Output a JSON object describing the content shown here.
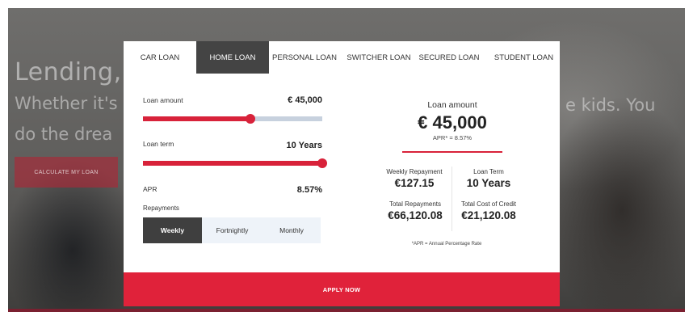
{
  "hero": {
    "title": "Lending,",
    "line1_left": "Whether it's",
    "line2_left": "do the drea",
    "line1_right": "e kids. You",
    "cta_label": "CALCULATE MY LOAN"
  },
  "calculator": {
    "tabs": [
      {
        "label": "CAR LOAN",
        "active": false
      },
      {
        "label": "HOME LOAN",
        "active": true
      },
      {
        "label": "PERSONAL LOAN",
        "active": false
      },
      {
        "label": "SWITCHER LOAN",
        "active": false
      },
      {
        "label": "SECURED LOAN",
        "active": false
      },
      {
        "label": "STUDENT LOAN",
        "active": false
      }
    ],
    "loan_amount": {
      "label": "Loan amount",
      "value": "€ 45,000",
      "slider_fraction": 0.6
    },
    "loan_term": {
      "label": "Loan term",
      "value": "10 Years",
      "slider_fraction": 1.0
    },
    "apr": {
      "label": "APR",
      "value": "8.57%"
    },
    "repayments": {
      "label": "Repayments",
      "options": [
        {
          "label": "Weekly",
          "active": true
        },
        {
          "label": "Fortnightly",
          "active": false
        },
        {
          "label": "Monthly",
          "active": false
        }
      ]
    },
    "summary": {
      "title": "Loan amount",
      "amount": "€ 45,000",
      "apr_line": "APR* = 8.57%",
      "weekly_repayment_label": "Weekly Repayment",
      "weekly_repayment_value": "€127.15",
      "loan_term_label": "Loan Term",
      "loan_term_value": "10 Years",
      "total_repayments_label": "Total Repayments",
      "total_repayments_value": "€66,120.08",
      "total_cost_label": "Total Cost of Credit",
      "total_cost_value": "€21,120.08",
      "footnote": "*APR = Annual Percentage Rate"
    },
    "apply_label": "APPLY NOW"
  },
  "colors": {
    "accent": "#d8223a",
    "active_tab": "#444444",
    "slider_track": "#c7d1de"
  }
}
